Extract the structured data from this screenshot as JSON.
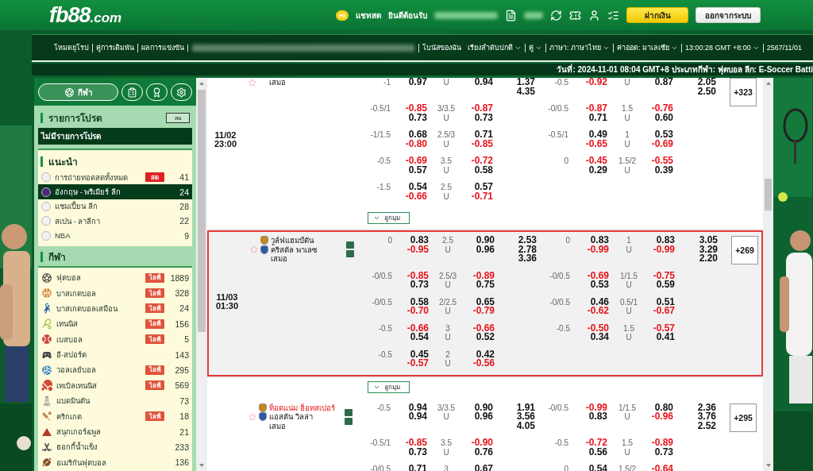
{
  "header": {
    "logo": "fb88",
    "logo_suffix": ".com",
    "chat_badge": "Hi",
    "chat": "แชทสด",
    "welcome": "ยินดีต้อนรับ",
    "deposit": "ฝากเงิน",
    "logout": "ออกจากระบบ"
  },
  "nav": [
    {
      "kind": "link",
      "label": "โหมดยุโรป",
      "divider": false
    },
    {
      "kind": "link",
      "label": "คู่การเดิมพัน",
      "divider": true
    },
    {
      "kind": "link",
      "label": "ผลการแข่งขัน",
      "divider": true
    },
    {
      "kind": "blurred",
      "divider": true
    },
    {
      "kind": "link",
      "label": "โบนัสของฉัน",
      "divider": true
    },
    {
      "kind": "dropdown",
      "label": "เรียงลำดับปกติ",
      "divider": false
    },
    {
      "kind": "dropdown",
      "label": "คู่",
      "divider": true
    },
    {
      "kind": "dropdown",
      "label": "ภาษา: ภาษาไทย",
      "divider": true
    },
    {
      "kind": "dropdown",
      "label": "ค่าออด: มาเลเซีย",
      "divider": true
    },
    {
      "kind": "dropdown",
      "label": "13:00:28 GMT +8:00",
      "divider": true
    },
    {
      "kind": "link",
      "label": "2567/11/01",
      "divider": true
    }
  ],
  "ticker": "วันที่: 2024-11-01 08:04 GMT+8 ประเภทกีฬา: ฟุตบอล ลีก: E-Soccer Batti",
  "sidebar": {
    "tabs": [
      {
        "kind": "sports",
        "label": "กีฬา",
        "selected": true
      },
      {
        "kind": "slip",
        "selected": false
      },
      {
        "kind": "award",
        "selected": false
      },
      {
        "kind": "settings",
        "selected": false
      }
    ],
    "favorites": {
      "title": "รายการโปรด",
      "button": "ลบ",
      "empty": "ไม่มีรายการโปรด"
    },
    "recommended": {
      "title": "แนะนำ",
      "items": [
        {
          "name": "การถ่ายทอดสดทั้งหมด",
          "badge": "สด",
          "count": "41",
          "selected": false
        },
        {
          "name": "อังกฤษ - พรีเมียร์ ลีก",
          "count": "24",
          "selected": true
        },
        {
          "name": "แชมเปี้ยน ลีก",
          "count": "28",
          "selected": false
        },
        {
          "name": "สเปน - ลาลีกา",
          "count": "22",
          "selected": false
        },
        {
          "name": "NBA",
          "count": "9",
          "selected": false
        }
      ]
    },
    "sports": {
      "title": "กีฬา",
      "items": [
        {
          "kind": "soccer",
          "name": "ฟุตบอล",
          "badge": "ไลฟ์",
          "count": "1889"
        },
        {
          "kind": "basketball",
          "name": "บาสเกตบอล",
          "badge": "ไลฟ์",
          "count": "328"
        },
        {
          "kind": "virtual",
          "name": "บาสเกตบอลเสมือน",
          "badge": "ไลฟ์",
          "count": "24"
        },
        {
          "kind": "tennis",
          "name": "เทนนิส",
          "badge": "ไลฟ์",
          "count": "156"
        },
        {
          "kind": "baseball",
          "name": "เบสบอล",
          "badge": "ไลฟ์",
          "count": "5"
        },
        {
          "kind": "esports",
          "name": "อี-สปอร์ต",
          "count": "143"
        },
        {
          "kind": "volleyball",
          "name": "วอลเลย์บอล",
          "badge": "ไลฟ์",
          "count": "295"
        },
        {
          "kind": "tabletennis",
          "name": "เทเบิลเทนนิส",
          "badge": "ไลฟ์",
          "count": "569"
        },
        {
          "kind": "badminton",
          "name": "แบดมินตัน",
          "count": "73"
        },
        {
          "kind": "cricket",
          "name": "คริกเกต",
          "badge": "ไลฟ์",
          "count": "18"
        },
        {
          "kind": "snooker",
          "name": "สนุกเกอร์&พูล",
          "count": "21"
        },
        {
          "kind": "hockey",
          "name": "ฮอกกี้น้ำแข็ง",
          "count": "233"
        },
        {
          "kind": "football",
          "name": "อเมริกันฟุตบอล",
          "count": "136"
        }
      ]
    }
  },
  "matches": [
    {
      "time": [
        "11/02",
        "23:00"
      ],
      "draw": "เสมอ",
      "more": "+323",
      "highlighted": false,
      "expand": "ลูกมุม",
      "lines": [
        {
          "hdp": "-1",
          "home": [
            "0.97"
          ],
          "side": "U",
          "away": [
            "0.94"
          ],
          "x12": [
            "1.37",
            "4.35"
          ],
          "h_hdp": "-0.5",
          "h_home": [
            "-0.92"
          ],
          "h_side": "U",
          "h_away": [
            "0.87"
          ],
          "h_x12": [
            "2.05",
            "2.50"
          ],
          "red": {
            "home": [
              false
            ],
            "away": [
              false
            ],
            "h_home": [
              true
            ],
            "h_away": [
              false
            ]
          }
        },
        {
          "hdp": "-0.5/1",
          "home": [
            "-0.85",
            "0.73"
          ],
          "ou": "3/3.5",
          "side": "U",
          "away": [
            "-0.87",
            "0.73"
          ],
          "h_hdp": "-0/0.5",
          "h_home": [
            "-0.87",
            "0.71"
          ],
          "h_ou": "1.5",
          "h_side": "U",
          "h_away": [
            "-0.76",
            "0.60"
          ],
          "red": {
            "home": [
              true,
              false
            ],
            "away": [
              true,
              false
            ],
            "h_home": [
              true,
              false
            ],
            "h_away": [
              true,
              false
            ]
          }
        },
        {
          "hdp": "-1/1.5",
          "home": [
            "0.68",
            "-0.80"
          ],
          "ou": "2.5/3",
          "side": "U",
          "away": [
            "0.71",
            "-0.85"
          ],
          "h_hdp": "-0.5/1",
          "h_home": [
            "0.49",
            "-0.65"
          ],
          "h_ou": "1",
          "h_side": "U",
          "h_away": [
            "0.53",
            "-0.69"
          ],
          "red": {
            "home": [
              false,
              true
            ],
            "away": [
              false,
              true
            ],
            "h_home": [
              false,
              true
            ],
            "h_away": [
              false,
              true
            ]
          }
        },
        {
          "hdp": "-0.5",
          "home": [
            "-0.69",
            "0.57"
          ],
          "ou": "3.5",
          "side": "U",
          "away": [
            "-0.72",
            "0.58"
          ],
          "h_hdp": "0",
          "h_home": [
            "-0.45",
            "0.29"
          ],
          "h_ou": "1.5/2",
          "h_side": "U",
          "h_away": [
            "-0.55",
            "0.39"
          ],
          "red": {
            "home": [
              true,
              false
            ],
            "away": [
              true,
              false
            ],
            "h_home": [
              true,
              false
            ],
            "h_away": [
              true,
              false
            ]
          }
        },
        {
          "hdp": "-1.5",
          "home": [
            "0.54",
            "-0.66"
          ],
          "ou": "2.5",
          "side": "U",
          "away": [
            "0.57",
            "-0.71"
          ],
          "red": {
            "home": [
              false,
              true
            ],
            "away": [
              false,
              true
            ]
          }
        }
      ]
    },
    {
      "time": [
        "11/03",
        "01:30"
      ],
      "teams": [
        {
          "name": "วูล์ฟแฮมป์ตัน",
          "favored": false
        },
        {
          "name": "คริสตัล พาเลซ",
          "favored": false
        }
      ],
      "draw": "เสมอ",
      "more": "+269",
      "highlighted": true,
      "expand": "ลูกมุม",
      "lines": [
        {
          "hdp": "0",
          "home": [
            "0.83",
            "-0.95"
          ],
          "ou": "2.5",
          "side": "U",
          "away": [
            "0.90",
            "0.96"
          ],
          "x12": [
            "2.53",
            "2.78",
            "3.36"
          ],
          "h_hdp": "0",
          "h_home": [
            "0.83",
            "-0.99"
          ],
          "h_ou": "1",
          "h_side": "U",
          "h_away": [
            "0.83",
            "-0.99"
          ],
          "h_x12": [
            "3.05",
            "3.29",
            "2.20"
          ],
          "red": {
            "home": [
              false,
              true
            ],
            "away": [
              false,
              false
            ],
            "h_home": [
              false,
              true
            ],
            "h_away": [
              false,
              true
            ]
          }
        },
        {
          "hdp": "-0/0.5",
          "home": [
            "-0.85",
            "0.73"
          ],
          "ou": "2.5/3",
          "side": "U",
          "away": [
            "-0.89",
            "0.75"
          ],
          "h_hdp": "-0/0.5",
          "h_home": [
            "-0.69",
            "0.53"
          ],
          "h_ou": "1/1.5",
          "h_side": "U",
          "h_away": [
            "-0.75",
            "0.59"
          ],
          "red": {
            "home": [
              true,
              false
            ],
            "away": [
              true,
              false
            ],
            "h_home": [
              true,
              false
            ],
            "h_away": [
              true,
              false
            ]
          }
        },
        {
          "hdp": "-0/0.5",
          "home": [
            "0.58",
            "-0.70"
          ],
          "ou": "2/2.5",
          "side": "U",
          "away": [
            "0.65",
            "-0.79"
          ],
          "h_hdp": "-0/0.5",
          "h_home": [
            "0.46",
            "-0.62"
          ],
          "h_ou": "0.5/1",
          "h_side": "U",
          "h_away": [
            "0.51",
            "-0.67"
          ],
          "red": {
            "home": [
              false,
              true
            ],
            "away": [
              false,
              true
            ],
            "h_home": [
              false,
              true
            ],
            "h_away": [
              false,
              true
            ]
          }
        },
        {
          "hdp": "-0.5",
          "home": [
            "-0.66",
            "0.54"
          ],
          "ou": "3",
          "side": "U",
          "away": [
            "-0.66",
            "0.52"
          ],
          "h_hdp": "-0.5",
          "h_home": [
            "-0.50",
            "0.34"
          ],
          "h_ou": "1.5",
          "h_side": "U",
          "h_away": [
            "-0.57",
            "0.41"
          ],
          "red": {
            "home": [
              true,
              false
            ],
            "away": [
              true,
              false
            ],
            "h_home": [
              true,
              false
            ],
            "h_away": [
              true,
              false
            ]
          }
        },
        {
          "hdp": "-0.5",
          "home": [
            "0.45",
            "-0.57"
          ],
          "ou": "2",
          "side": "U",
          "away": [
            "0.42",
            "-0.56"
          ],
          "red": {
            "home": [
              false,
              true
            ],
            "away": [
              false,
              true
            ]
          }
        }
      ]
    },
    {
      "teams": [
        {
          "name": "ท็อตแน่ม ฮ็อทสเปอร์",
          "favored": true
        },
        {
          "name": "แอสตัน วิลล่า",
          "favored": false
        }
      ],
      "draw": "เสมอ",
      "more": "+295",
      "highlighted": false,
      "lines": [
        {
          "hdp": "-0.5",
          "home": [
            "0.94",
            "0.94"
          ],
          "ou": "3/3.5",
          "side": "U",
          "away": [
            "0.90",
            "0.96"
          ],
          "x12": [
            "1.91",
            "3.56",
            "4.05"
          ],
          "h_hdp": "-0/0.5",
          "h_home": [
            "-0.99",
            "0.83"
          ],
          "h_ou": "1/1.5",
          "h_side": "U",
          "h_away": [
            "0.80",
            "-0.96"
          ],
          "h_x12": [
            "2.36",
            "3.76",
            "2.52"
          ],
          "red": {
            "home": [
              false,
              false
            ],
            "away": [
              false,
              false
            ],
            "h_home": [
              true,
              false
            ],
            "h_away": [
              false,
              true
            ]
          }
        },
        {
          "hdp": "-0.5/1",
          "home": [
            "-0.85",
            "0.73"
          ],
          "ou": "3.5",
          "side": "U",
          "away": [
            "-0.90",
            "0.76"
          ],
          "h_hdp": "-0.5",
          "h_home": [
            "-0.72",
            "0.56"
          ],
          "h_ou": "1.5",
          "h_side": "U",
          "h_away": [
            "-0.89",
            "0.73"
          ],
          "red": {
            "home": [
              true,
              false
            ],
            "away": [
              true,
              false
            ],
            "h_home": [
              true,
              false
            ],
            "h_away": [
              true,
              false
            ]
          }
        },
        {
          "hdp": "-0/0.5",
          "home": [
            "0.71"
          ],
          "ou": "3",
          "away": [
            "0.67"
          ],
          "h_hdp": "0",
          "h_home": [
            "0.54"
          ],
          "h_ou": "1.5/2",
          "h_away": [
            "-0.64"
          ],
          "red": {
            "home": [
              false
            ],
            "away": [
              false
            ],
            "h_home": [
              false
            ],
            "h_away": [
              true
            ]
          }
        }
      ]
    }
  ]
}
